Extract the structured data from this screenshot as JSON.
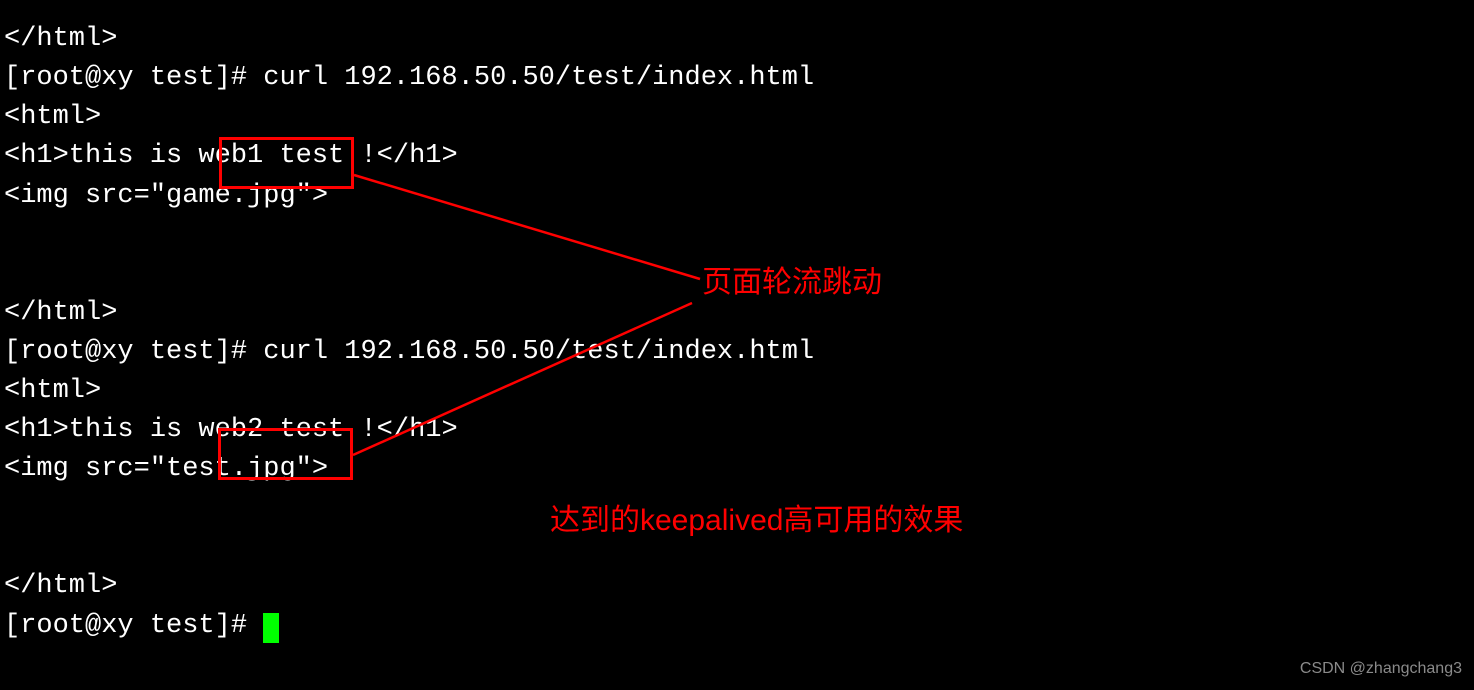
{
  "terminal": {
    "lines": {
      "l1": "</html>",
      "l2": "[root@xy test]# curl 192.168.50.50/test/index.html",
      "l3": "<html>",
      "l4": "<h1>this is web1 test !</h1>",
      "l5": "<img src=\"game.jpg\">",
      "l6": "</html>",
      "l7": "[root@xy test]# curl 192.168.50.50/test/index.html",
      "l8": "<html>",
      "l9": "<h1>this is web2 test !</h1>",
      "l10": "<img src=\"test.jpg\">",
      "l11": "</html>",
      "l12": "[root@xy test]# "
    }
  },
  "annotations": {
    "top": "页面轮流跳动",
    "bottom": "达到的keepalived高可用的效果"
  },
  "watermark": "CSDN @zhangchang3"
}
